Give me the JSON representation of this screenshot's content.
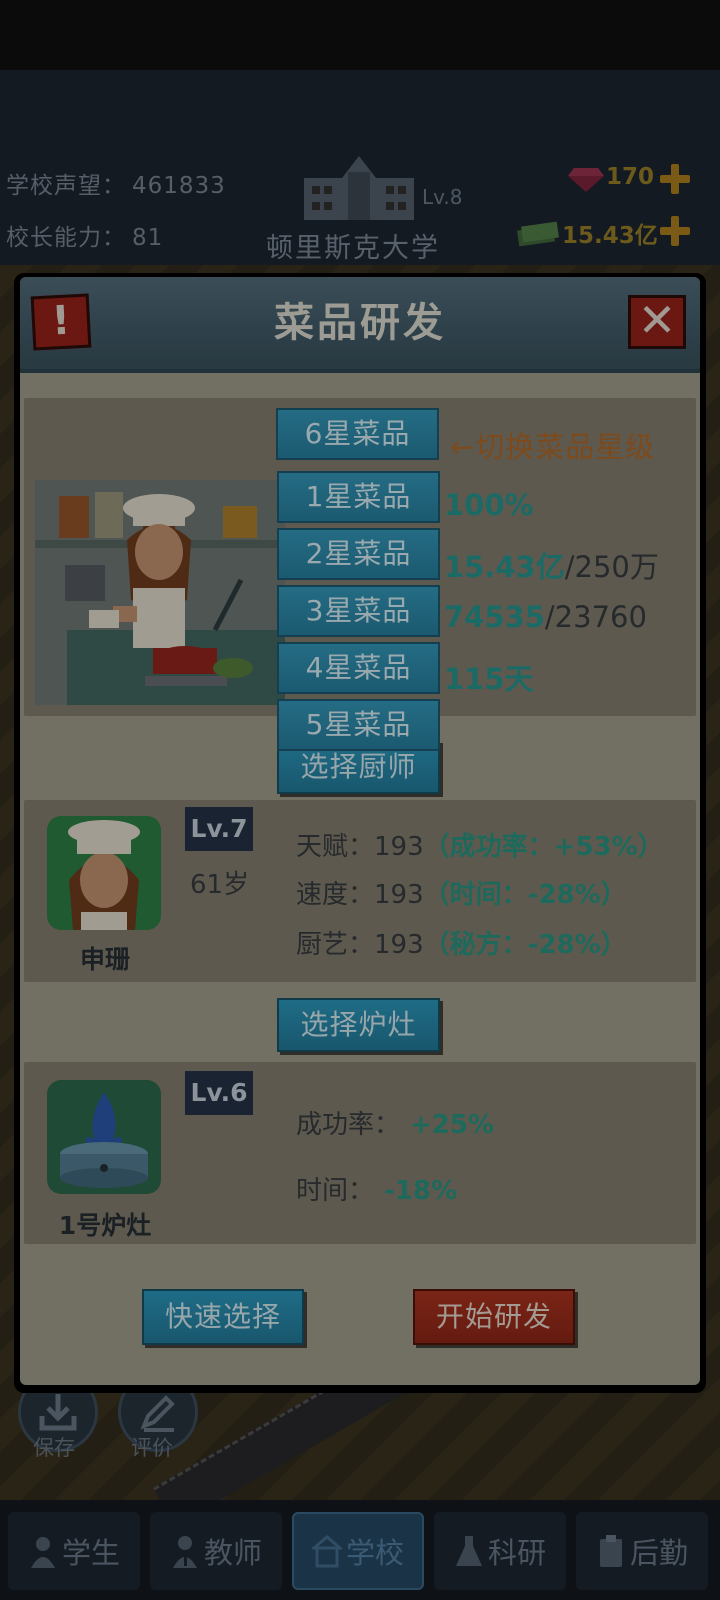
{
  "hud": {
    "reputation_label": "学校声望：",
    "reputation_value": "461833",
    "ability_label": "校长能力：",
    "ability_value": "81",
    "school_level": "Lv.8",
    "school_name": "顿里斯克大学",
    "gems": "170",
    "money": "15.43亿"
  },
  "side_buttons": [
    {
      "label": "保存",
      "icon": "download-icon"
    },
    {
      "label": "评价",
      "icon": "pencil-icon"
    }
  ],
  "tabs": [
    {
      "label": "学生",
      "icon": "student-icon"
    },
    {
      "label": "教师",
      "icon": "teacher-icon"
    },
    {
      "label": "学校",
      "icon": "school-icon",
      "active": true
    },
    {
      "label": "科研",
      "icon": "flask-icon"
    },
    {
      "label": "后勤",
      "icon": "clipboard-icon"
    }
  ],
  "modal": {
    "title": "菜品研发",
    "alert_icon": "!",
    "close_icon": "✕",
    "dish": {
      "hint": "←切换菜品星级",
      "success_rate": "100%",
      "cost_have": "15.43亿",
      "cost_need": "/250万",
      "points_have": "74535",
      "points_need": "/23760",
      "days": "115天"
    },
    "dropdown": {
      "current": "6星菜品",
      "options": [
        "1星菜品",
        "2星菜品",
        "3星菜品",
        "4星菜品",
        "5星菜品"
      ]
    },
    "select_chef_label": "选择厨师",
    "chef": {
      "level": "Lv.7",
      "age": "61岁",
      "name": "申珊",
      "talent_label": "天赋：",
      "talent_value": "193",
      "talent_bonus": "（成功率：+53%）",
      "speed_label": "速度：",
      "speed_value": "193",
      "speed_bonus": "（时间：-28%）",
      "craft_label": "厨艺：",
      "craft_value": "193",
      "craft_bonus": "（秘方：-28%）"
    },
    "select_stove_label": "选择炉灶",
    "stove": {
      "level": "Lv.6",
      "name": "1号炉灶",
      "success_label": "成功率：",
      "success_bonus": "+25%",
      "time_label": "时间：",
      "time_bonus": "-18%"
    },
    "quick_select_label": "快速选择",
    "start_label": "开始研发"
  },
  "colors": {
    "accent_teal": "#1d6a5d",
    "button_blue": "#1f6c86",
    "button_red": "#7a2416",
    "hint_orange": "#7c4a1c"
  }
}
